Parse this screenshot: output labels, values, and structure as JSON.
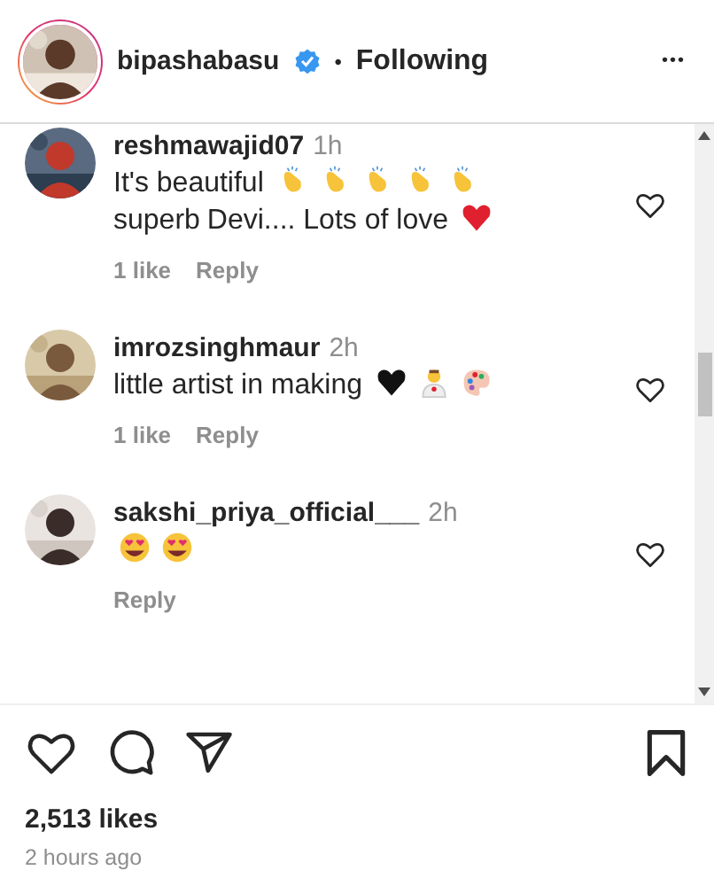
{
  "header": {
    "username": "bipashabasu",
    "verified": true,
    "separator": "•",
    "follow_status": "Following",
    "more": "•••"
  },
  "comments": [
    {
      "username": "reshmawajid07",
      "time": "1h",
      "segments": [
        {
          "kind": "text",
          "text": "It's beautiful"
        },
        {
          "kind": "clap"
        },
        {
          "kind": "clap"
        },
        {
          "kind": "clap"
        },
        {
          "kind": "clap"
        },
        {
          "kind": "clap"
        },
        {
          "kind": "text",
          "text": "superb"
        },
        {
          "kind": "text",
          "text": "Devi.... Lots of love"
        },
        {
          "kind": "red-heart"
        }
      ],
      "likes": "1 like",
      "reply": "Reply"
    },
    {
      "username": "imrozsinghmaur",
      "time": "2h",
      "segments": [
        {
          "kind": "text",
          "text": "little artist in making"
        },
        {
          "kind": "black-heart"
        },
        {
          "kind": "artist"
        },
        {
          "kind": "palette"
        }
      ],
      "likes": "1 like",
      "reply": "Reply"
    },
    {
      "username": "sakshi_priya_official___",
      "time": "2h",
      "segments": [
        {
          "kind": "heart-eyes"
        },
        {
          "kind": "heart-eyes"
        }
      ],
      "reply": "Reply"
    }
  ],
  "likes": "2,513 likes",
  "posted": "2 hours ago"
}
